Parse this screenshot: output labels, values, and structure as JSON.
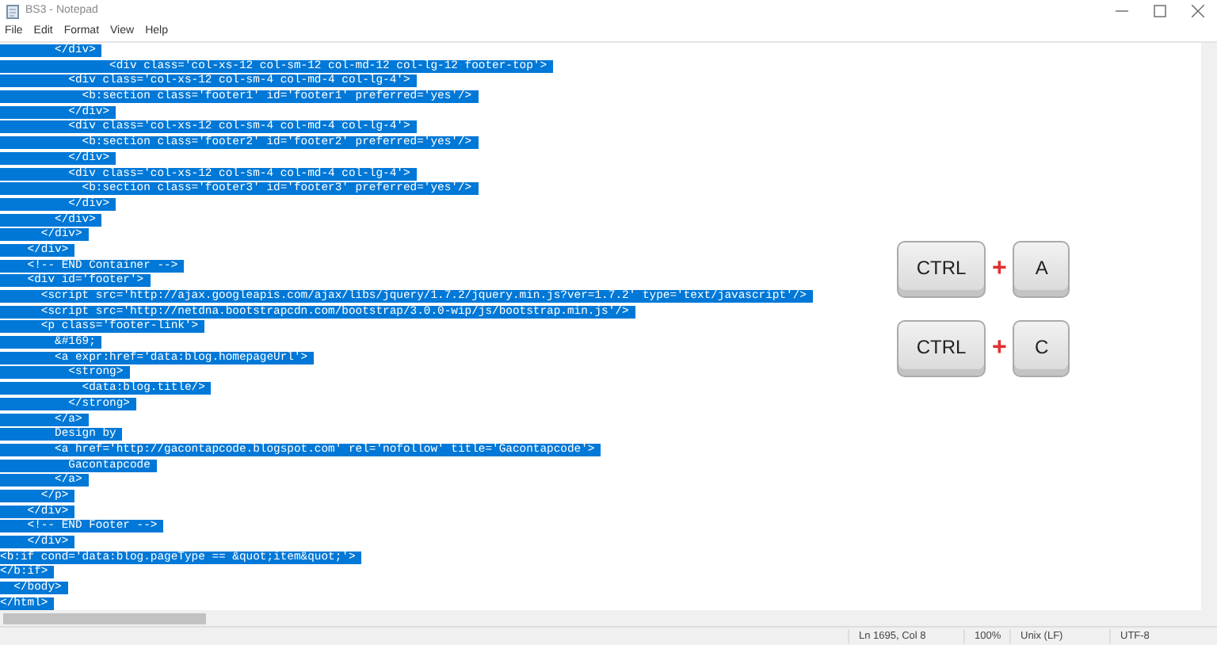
{
  "window": {
    "title": "BS3 - Notepad"
  },
  "menu": [
    "File",
    "Edit",
    "Format",
    "View",
    "Help"
  ],
  "editor": {
    "lines": [
      {
        "text": "        </div>",
        "selected": true
      },
      {
        "text": "                <div class='col-xs-12 col-sm-12 col-md-12 col-lg-12 footer-top'>",
        "selected": true
      },
      {
        "text": "          <div class='col-xs-12 col-sm-4 col-md-4 col-lg-4'>",
        "selected": true
      },
      {
        "text": "            <b:section class='footer1' id='footer1' preferred='yes'/>",
        "selected": true
      },
      {
        "text": "          </div>",
        "selected": true
      },
      {
        "text": "          <div class='col-xs-12 col-sm-4 col-md-4 col-lg-4'>",
        "selected": true
      },
      {
        "text": "            <b:section class='footer2' id='footer2' preferred='yes'/>",
        "selected": true
      },
      {
        "text": "          </div>",
        "selected": true
      },
      {
        "text": "          <div class='col-xs-12 col-sm-4 col-md-4 col-lg-4'>",
        "selected": true
      },
      {
        "text": "            <b:section class='footer3' id='footer3' preferred='yes'/>",
        "selected": true
      },
      {
        "text": "          </div>",
        "selected": true
      },
      {
        "text": "        </div>",
        "selected": true
      },
      {
        "text": "      </div>",
        "selected": true
      },
      {
        "text": "    </div>",
        "selected": true
      },
      {
        "text": "    <!-- END Container -->",
        "selected": true
      },
      {
        "text": "    <div id='footer'>",
        "selected": true
      },
      {
        "text": "      <script src='http://ajax.googleapis.com/ajax/libs/jquery/1.7.2/jquery.min.js?ver=1.7.2' type='text/javascript'/>",
        "selected": true
      },
      {
        "text": "      <script src='http://netdna.bootstrapcdn.com/bootstrap/3.0.0-wip/js/bootstrap.min.js'/>",
        "selected": true
      },
      {
        "text": "      <p class='footer-link'>",
        "selected": true
      },
      {
        "text": "        &#169;",
        "selected": true
      },
      {
        "text": "        <a expr:href='data:blog.homepageUrl'>",
        "selected": true
      },
      {
        "text": "          <strong>",
        "selected": true
      },
      {
        "text": "            <data:blog.title/>",
        "selected": true
      },
      {
        "text": "          </strong>",
        "selected": true
      },
      {
        "text": "        </a>",
        "selected": true
      },
      {
        "text": "        Design by",
        "selected": true
      },
      {
        "text": "        <a href='http://gacontapcode.blogspot.com' rel='nofollow' title='Gacontapcode'>",
        "selected": true
      },
      {
        "text": "          Gacontapcode",
        "selected": true
      },
      {
        "text": "        </a>",
        "selected": true
      },
      {
        "text": "      </p>",
        "selected": true
      },
      {
        "text": "    </div>",
        "selected": true
      },
      {
        "text": "    <!-- END Footer -->",
        "selected": true
      },
      {
        "text": "    </div>",
        "selected": true
      },
      {
        "text": "<b:if cond='data:blog.pageType == &quot;item&quot;'>",
        "selected": true
      },
      {
        "text": "</b:if>",
        "selected": true
      },
      {
        "text": "  </body>",
        "selected": true
      },
      {
        "text": "</html>",
        "selected": true
      }
    ]
  },
  "shortcuts": [
    {
      "keys": [
        "CTRL",
        "A"
      ],
      "joiner": "+"
    },
    {
      "keys": [
        "CTRL",
        "C"
      ],
      "joiner": "+"
    }
  ],
  "status_bar": [
    "Ln 1695, Col 8",
    "100%",
    "Unix (LF)",
    "UTF-8"
  ]
}
